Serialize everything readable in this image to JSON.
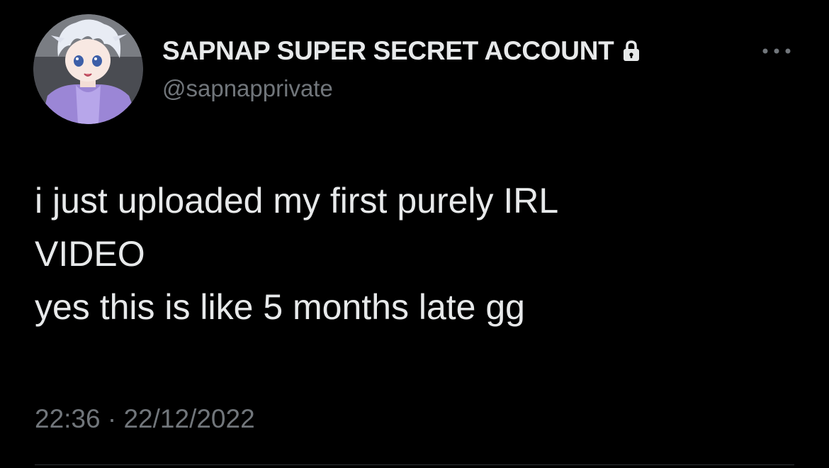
{
  "profile": {
    "display_name": "SAPNAP SUPER SECRET ACCOUNT",
    "handle": "@sapnapprivate",
    "protected_icon": "lock-icon",
    "avatar_description_icon": "avatar"
  },
  "tweet": {
    "text": "i just uploaded my first purely IRL\nVIDEO\nyes this is like 5 months late gg",
    "time": "22:36",
    "separator": "·",
    "date": "22/12/2022"
  },
  "menu": {
    "icon": "more-options-icon"
  },
  "colors": {
    "background": "#000000",
    "primary_text": "#e7e9ea",
    "secondary_text": "#71767b",
    "divider": "#2f3336"
  }
}
